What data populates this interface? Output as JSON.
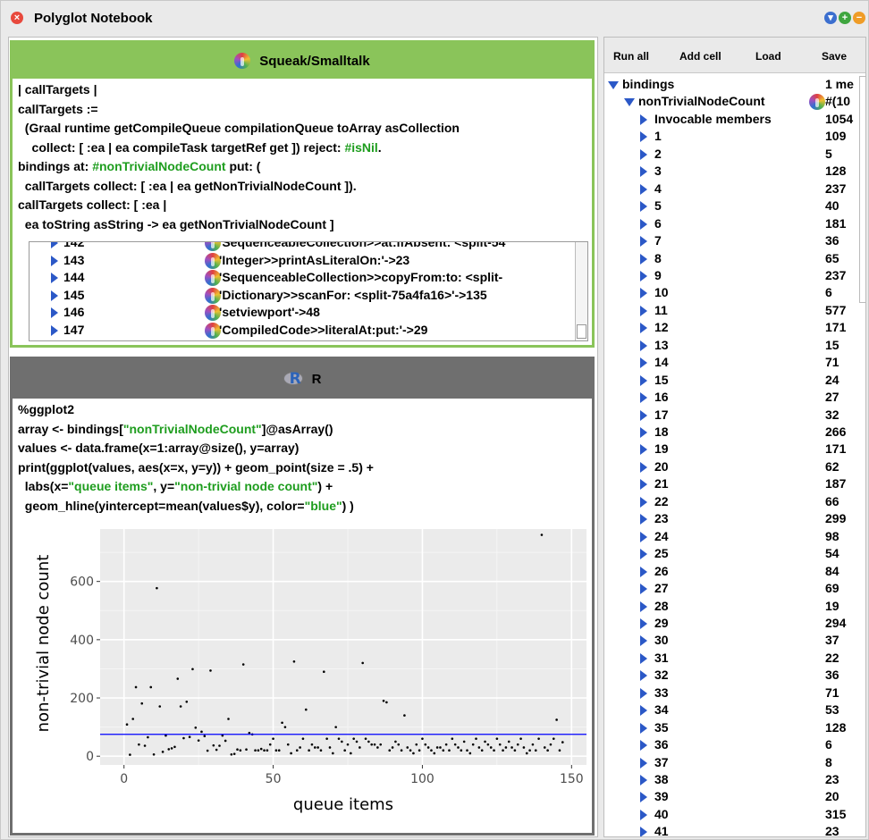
{
  "window": {
    "title": "Polyglot Notebook"
  },
  "toolbar": {
    "run_all": "Run all",
    "add_cell": "Add cell",
    "load": "Load",
    "save": "Save"
  },
  "cell1": {
    "language": "Squeak/Smalltalk",
    "code_lines": [
      [
        {
          "t": "| callTargets |"
        }
      ],
      [
        {
          "t": "callTargets :="
        }
      ],
      [
        {
          "t": "  (Graal runtime getCompileQueue compilationQueue toArray asCollection"
        }
      ],
      [
        {
          "t": "    collect: [ :ea | ea compileTask targetRef get ]) reject: "
        },
        {
          "t": "#isNil",
          "g": true
        },
        {
          "t": "."
        }
      ],
      [
        {
          "t": "bindings at: "
        },
        {
          "t": "#nonTrivialNodeCount",
          "g": true
        },
        {
          "t": " put: ("
        }
      ],
      [
        {
          "t": "  callTargets collect: [ :ea | ea getNonTrivialNodeCount ])."
        }
      ],
      [
        {
          "t": "callTargets collect: [ :ea |"
        }
      ],
      [
        {
          "t": "  ea toString asString -> ea getNonTrivialNodeCount ]"
        }
      ]
    ],
    "result_rows": [
      {
        "key": "142",
        "value": "'SequenceableCollection>>at:ifAbsent: <split-54"
      },
      {
        "key": "143",
        "value": "'Integer>>printAsLiteralOn:'->23"
      },
      {
        "key": "144",
        "value": "'SequenceableCollection>>copyFrom:to: <split-"
      },
      {
        "key": "145",
        "value": "'Dictionary>>scanFor: <split-75a4fa16>'->135"
      },
      {
        "key": "146",
        "value": "'setviewport'->48"
      },
      {
        "key": "147",
        "value": "'CompiledCode>>literalAt:put:'->29"
      }
    ]
  },
  "cell2": {
    "language": "R",
    "code_lines": [
      [
        {
          "t": "%ggplot2"
        }
      ],
      [
        {
          "t": "array <- bindings["
        },
        {
          "t": "\"nonTrivialNodeCount\"",
          "g": true
        },
        {
          "t": "]@asArray()"
        }
      ],
      [
        {
          "t": "values <- data.frame(x=1:array@size(), y=array)"
        }
      ],
      [
        {
          "t": "print(ggplot(values, aes(x=x, y=y)) + geom_point(size = .5) +"
        }
      ],
      [
        {
          "t": "  labs(x="
        },
        {
          "t": "\"queue items\"",
          "g": true
        },
        {
          "t": ", y="
        },
        {
          "t": "\"non-trivial node count\"",
          "g": true
        },
        {
          "t": ") +"
        }
      ],
      [
        {
          "t": "  geom_hline(yintercept=mean(values$y), color="
        },
        {
          "t": "\"blue\"",
          "g": true
        },
        {
          "t": ") )"
        }
      ]
    ]
  },
  "chart_data": {
    "type": "scatter",
    "xlabel": "queue items",
    "ylabel": "non-trivial node count",
    "xlim": [
      -8,
      155
    ],
    "ylim": [
      -30,
      780
    ],
    "xticks": [
      0,
      50,
      100,
      150
    ],
    "yticks": [
      0,
      200,
      400,
      600
    ],
    "grid": true,
    "hline": {
      "y": 75,
      "color": "#0000ff"
    },
    "x": [
      1,
      2,
      3,
      4,
      5,
      6,
      7,
      8,
      9,
      10,
      11,
      12,
      13,
      14,
      15,
      16,
      17,
      18,
      19,
      20,
      21,
      22,
      23,
      24,
      25,
      26,
      27,
      28,
      29,
      30,
      31,
      32,
      33,
      34,
      35,
      36,
      37,
      38,
      39,
      40,
      41,
      42,
      43,
      44,
      45,
      46,
      47,
      48,
      49,
      50,
      51,
      52,
      53,
      54,
      55,
      56,
      57,
      58,
      59,
      60,
      61,
      62,
      63,
      64,
      65,
      66,
      67,
      68,
      69,
      70,
      71,
      72,
      73,
      74,
      75,
      76,
      77,
      78,
      79,
      80,
      81,
      82,
      83,
      84,
      85,
      86,
      87,
      88,
      89,
      90,
      91,
      92,
      93,
      94,
      95,
      96,
      97,
      98,
      99,
      100,
      101,
      102,
      103,
      104,
      105,
      106,
      107,
      108,
      109,
      110,
      111,
      112,
      113,
      114,
      115,
      116,
      117,
      118,
      119,
      120,
      121,
      122,
      123,
      124,
      125,
      126,
      127,
      128,
      129,
      130,
      131,
      132,
      133,
      134,
      135,
      136,
      137,
      138,
      139,
      140,
      141,
      142,
      143,
      144,
      145,
      146,
      147
    ],
    "y": [
      109,
      5,
      128,
      237,
      40,
      181,
      36,
      65,
      237,
      6,
      577,
      171,
      15,
      71,
      24,
      27,
      32,
      266,
      171,
      62,
      187,
      66,
      299,
      98,
      54,
      84,
      69,
      19,
      294,
      37,
      22,
      36,
      71,
      53,
      128,
      6,
      8,
      23,
      20,
      315,
      23,
      80,
      75,
      20,
      20,
      25,
      20,
      20,
      40,
      60,
      20,
      20,
      115,
      100,
      40,
      10,
      325,
      20,
      30,
      60,
      160,
      20,
      40,
      30,
      30,
      20,
      290,
      60,
      30,
      10,
      100,
      60,
      50,
      20,
      40,
      10,
      60,
      50,
      30,
      320,
      60,
      50,
      40,
      40,
      30,
      40,
      190,
      185,
      20,
      30,
      50,
      40,
      20,
      140,
      30,
      20,
      10,
      40,
      20,
      60,
      40,
      30,
      20,
      10,
      30,
      30,
      20,
      40,
      20,
      60,
      40,
      30,
      20,
      50,
      20,
      10,
      40,
      60,
      30,
      20,
      50,
      40,
      30,
      20,
      60,
      40,
      20,
      30,
      50,
      30,
      20,
      40,
      60,
      30,
      10,
      20,
      40,
      20,
      60,
      760,
      30,
      20,
      40,
      60,
      125,
      20,
      48,
      135,
      29
    ]
  },
  "tree": {
    "root_label": "bindings",
    "root_value": "1 me",
    "child_label": "nonTrivialNodeCount",
    "child_value": "#(10",
    "members_label": "Invocable members",
    "members_value": "1054",
    "items": [
      {
        "k": "1",
        "v": "109"
      },
      {
        "k": "2",
        "v": "5"
      },
      {
        "k": "3",
        "v": "128"
      },
      {
        "k": "4",
        "v": "237"
      },
      {
        "k": "5",
        "v": "40"
      },
      {
        "k": "6",
        "v": "181"
      },
      {
        "k": "7",
        "v": "36"
      },
      {
        "k": "8",
        "v": "65"
      },
      {
        "k": "9",
        "v": "237"
      },
      {
        "k": "10",
        "v": "6"
      },
      {
        "k": "11",
        "v": "577"
      },
      {
        "k": "12",
        "v": "171"
      },
      {
        "k": "13",
        "v": "15"
      },
      {
        "k": "14",
        "v": "71"
      },
      {
        "k": "15",
        "v": "24"
      },
      {
        "k": "16",
        "v": "27"
      },
      {
        "k": "17",
        "v": "32"
      },
      {
        "k": "18",
        "v": "266"
      },
      {
        "k": "19",
        "v": "171"
      },
      {
        "k": "20",
        "v": "62"
      },
      {
        "k": "21",
        "v": "187"
      },
      {
        "k": "22",
        "v": "66"
      },
      {
        "k": "23",
        "v": "299"
      },
      {
        "k": "24",
        "v": "98"
      },
      {
        "k": "25",
        "v": "54"
      },
      {
        "k": "26",
        "v": "84"
      },
      {
        "k": "27",
        "v": "69"
      },
      {
        "k": "28",
        "v": "19"
      },
      {
        "k": "29",
        "v": "294"
      },
      {
        "k": "30",
        "v": "37"
      },
      {
        "k": "31",
        "v": "22"
      },
      {
        "k": "32",
        "v": "36"
      },
      {
        "k": "33",
        "v": "71"
      },
      {
        "k": "34",
        "v": "53"
      },
      {
        "k": "35",
        "v": "128"
      },
      {
        "k": "36",
        "v": "6"
      },
      {
        "k": "37",
        "v": "8"
      },
      {
        "k": "38",
        "v": "23"
      },
      {
        "k": "39",
        "v": "20"
      },
      {
        "k": "40",
        "v": "315"
      },
      {
        "k": "41",
        "v": "23"
      }
    ]
  }
}
